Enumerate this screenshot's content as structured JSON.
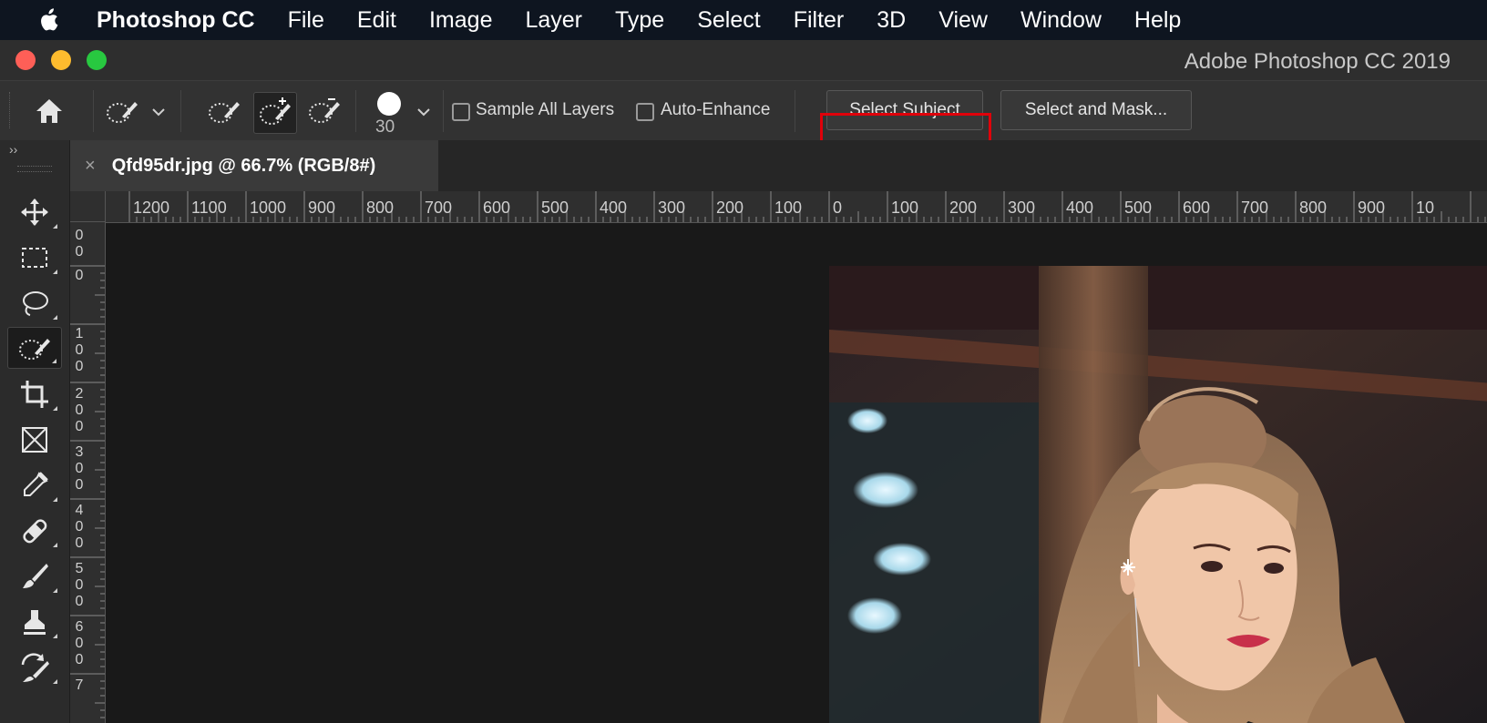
{
  "menubar": {
    "app_name": "Photoshop CC",
    "items": [
      "File",
      "Edit",
      "Image",
      "Layer",
      "Type",
      "Select",
      "Filter",
      "3D",
      "View",
      "Window",
      "Help"
    ],
    "icons": [
      "apple-icon"
    ]
  },
  "window": {
    "title": "Adobe Photoshop CC 2019",
    "traffic_lights": {
      "close": "#fe5f57",
      "minimize": "#febc2e",
      "zoom": "#28c840"
    }
  },
  "options_bar": {
    "brush_size": "30",
    "sample_all_layers_label": "Sample All Layers",
    "sample_all_layers_checked": false,
    "auto_enhance_label": "Auto-Enhance",
    "auto_enhance_checked": false,
    "select_subject_label": "Select Subject",
    "select_and_mask_label": "Select and Mask...",
    "icons": [
      "home-icon",
      "quick-selection-preset-icon",
      "new-selection-icon",
      "add-to-selection-icon",
      "subtract-from-selection-icon"
    ]
  },
  "toolbar": {
    "expand_label": "››",
    "tools": [
      "move-tool",
      "rectangular-marquee-tool",
      "lasso-tool",
      "quick-selection-tool",
      "crop-tool",
      "frame-tool",
      "eyedropper-tool",
      "healing-brush-tool",
      "brush-tool",
      "clone-stamp-tool",
      "history-brush-tool"
    ],
    "active_tool": "quick-selection-tool"
  },
  "document": {
    "tab_title": "Qfd95dr.jpg @ 66.7% (RGB/8#)",
    "close_label": "×"
  },
  "rulers": {
    "horizontal": [
      "1200",
      "1100",
      "1000",
      "900",
      "800",
      "700",
      "600",
      "500",
      "400",
      "300",
      "200",
      "100",
      "0",
      "100",
      "200",
      "300",
      "400",
      "500",
      "600",
      "700",
      "800",
      "900",
      "10"
    ],
    "vertical": [
      "0\n0",
      "0",
      "1\n0\n0",
      "2\n0\n0",
      "3\n0\n0",
      "4\n0\n0",
      "5\n0\n0",
      "6\n0\n0",
      "7"
    ]
  },
  "colors": {
    "highlight": "#e0000a",
    "menubar_bg": "#0e1520",
    "panel_bg": "#2b2b2b",
    "canvas_bg": "#191919"
  }
}
